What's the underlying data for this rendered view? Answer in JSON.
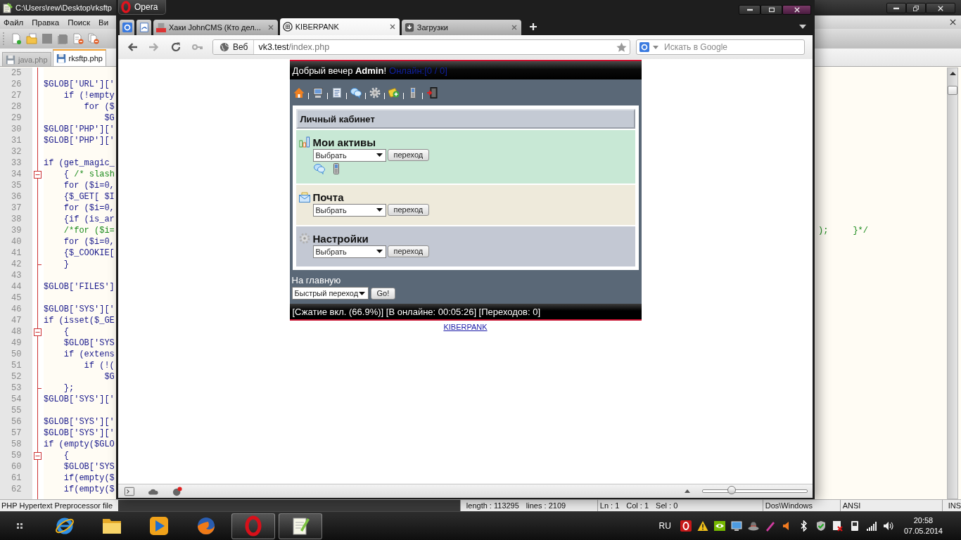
{
  "editor": {
    "title": "C:\\Users\\rew\\Desktop\\rksftp",
    "menu": [
      "Файл",
      "Правка",
      "Поиск",
      "Ви"
    ],
    "tabs": [
      {
        "label": "java.php",
        "selected": false
      },
      {
        "label": "rksftp.php",
        "selected": true
      }
    ],
    "lines": [
      {
        "number": "25",
        "kind": "line"
      },
      {
        "number": "26",
        "kind": "line",
        "code": "$GLOB['URL']['"
      },
      {
        "number": "27",
        "kind": "line",
        "code": "    if (!empty"
      },
      {
        "number": "28",
        "kind": "line",
        "code": "        for ($"
      },
      {
        "number": "29",
        "kind": "line",
        "code": "            $G"
      },
      {
        "number": "30",
        "kind": "line",
        "code": "$GLOB['PHP']['"
      },
      {
        "number": "31",
        "kind": "line",
        "code": "$GLOB['PHP']['"
      },
      {
        "number": "32",
        "kind": "line"
      },
      {
        "number": "33",
        "kind": "line",
        "code": "if (get_magic_"
      },
      {
        "number": "34",
        "kind": "fold-start",
        "code": "    {",
        "comment": " /* slash"
      },
      {
        "number": "35",
        "kind": "line",
        "code": "    for ($i=0,"
      },
      {
        "number": "36",
        "kind": "line",
        "code": "    {$_GET[ $I"
      },
      {
        "number": "37",
        "kind": "line",
        "code": "    for ($i=0,"
      },
      {
        "number": "38",
        "kind": "line",
        "code": "    {if (is_ar"
      },
      {
        "number": "39",
        "kind": "line",
        "comment": "    /*for ($i=",
        "tail": [
          ");",
          "}*/"
        ]
      },
      {
        "number": "40",
        "kind": "line",
        "code": "    for ($i=0,"
      },
      {
        "number": "41",
        "kind": "line",
        "code": "    {$_COOKIE["
      },
      {
        "number": "42",
        "kind": "fold-end",
        "code": "    }"
      },
      {
        "number": "43",
        "kind": "line"
      },
      {
        "number": "44",
        "kind": "line",
        "code": "$GLOB['FILES']"
      },
      {
        "number": "45",
        "kind": "line"
      },
      {
        "number": "46",
        "kind": "line",
        "code": "$GLOB['SYS']['"
      },
      {
        "number": "47",
        "kind": "line",
        "code": "if (isset($_GE"
      },
      {
        "number": "48",
        "kind": "fold-start",
        "code": "    {"
      },
      {
        "number": "49",
        "kind": "line",
        "code": "    $GLOB['SYS"
      },
      {
        "number": "50",
        "kind": "line",
        "code": "    if (extens"
      },
      {
        "number": "51",
        "kind": "line",
        "code": "        if (!("
      },
      {
        "number": "52",
        "kind": "line",
        "code": "            $G"
      },
      {
        "number": "53",
        "kind": "fold-end",
        "code": "    };"
      },
      {
        "number": "54",
        "kind": "line",
        "code": "$GLOB['SYS']['"
      },
      {
        "number": "55",
        "kind": "line"
      },
      {
        "number": "56",
        "kind": "line",
        "code": "$GLOB['SYS']['"
      },
      {
        "number": "57",
        "kind": "line",
        "code": "$GLOB['SYS']['"
      },
      {
        "number": "58",
        "kind": "line",
        "code": "if (empty($GLO"
      },
      {
        "number": "59",
        "kind": "fold-start",
        "code": "    {"
      },
      {
        "number": "60",
        "kind": "line",
        "code": "    $GLOB['SYS"
      },
      {
        "number": "61",
        "kind": "line",
        "code": "    if(empty($"
      },
      {
        "number": "62",
        "kind": "line",
        "code": "    if(empty($"
      }
    ],
    "status_bar": {
      "file_type": "PHP Hypertext Preprocessor file",
      "length": "length : 113295",
      "lines": "lines : 2109",
      "line": "Ln : 1",
      "column": "Col : 1",
      "selection": "Sel : 0",
      "line_endings": "Dos\\Windows",
      "encoding": "ANSI",
      "mode": "INS"
    }
  },
  "browser": {
    "menu_button": "Opera",
    "tabs": [
      {
        "label": "Хаки JohnCMS (Кто дел...",
        "selected": false
      },
      {
        "label": "KIBERPANK",
        "selected": true
      },
      {
        "label": "Загрузки",
        "selected": false
      }
    ],
    "address": {
      "badge": "Веб",
      "host": "vk3.test",
      "path": "/index.php"
    },
    "search": {
      "placeholder": "Искать в Google"
    },
    "zoom": {
      "level": 0.28
    },
    "page": {
      "greeting": "Добрый вечер **Admin**!",
      "online": "Онлайн:[0 / 0]",
      "panel_title": "Личный кабинет",
      "sections": [
        {
          "title": "Мои активы",
          "color": "#c8e8d5",
          "select": "Выбрать",
          "button": "переход",
          "shortcuts": true
        },
        {
          "title": "Почта",
          "color": "#eeeadb",
          "select": "Выбрать",
          "button": "переход",
          "shortcuts": false
        },
        {
          "title": "Настройки",
          "color": "#c3c8d3",
          "select": "Выбрать",
          "button": "переход",
          "shortcuts": false
        }
      ],
      "home_link": "На главную",
      "quick_nav": {
        "select": "Быстрый переход",
        "button": "Go!"
      },
      "footer": "[Сжатие вкл. (66.9%)] [В онлайне: 00:05:26] [Переходов: 0]",
      "site_link": "KIBERPANK"
    }
  },
  "taskbar": {
    "apps": [
      {
        "running": false
      },
      {
        "running": false
      },
      {
        "running": false
      },
      {
        "running": false
      },
      {
        "running": true
      },
      {
        "running": true
      }
    ],
    "language": "RU",
    "time": "20:58",
    "date": "07.05.2014"
  }
}
